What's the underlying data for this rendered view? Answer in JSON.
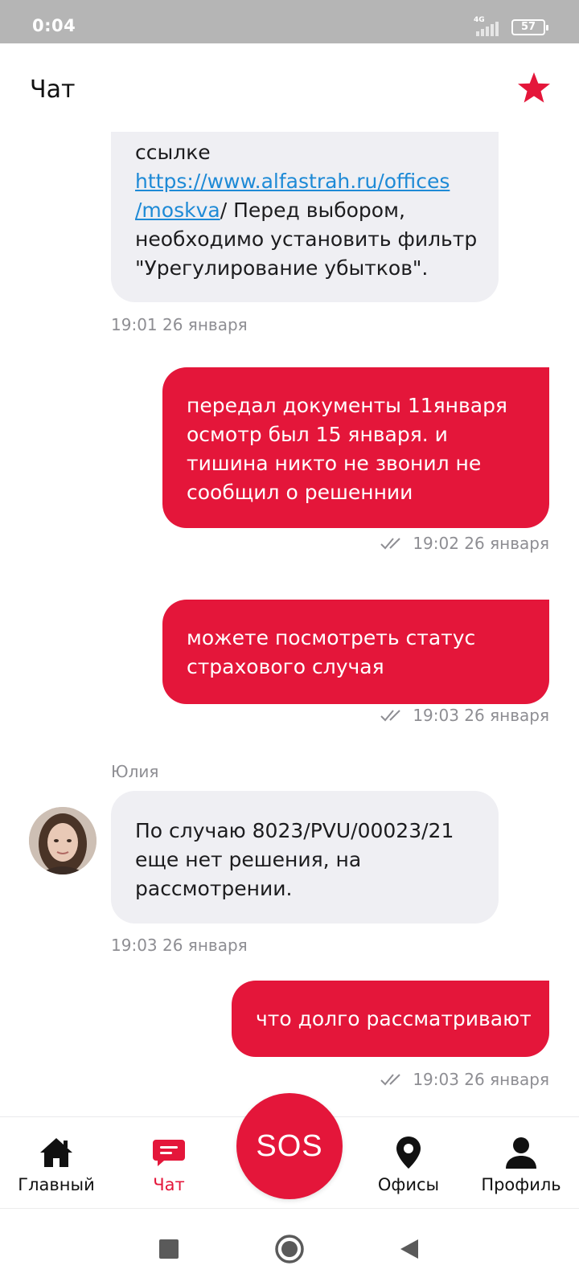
{
  "status_bar": {
    "time": "0:04",
    "network": "4G",
    "battery": "57"
  },
  "header": {
    "title": "Чат",
    "favorite_icon": "star-icon",
    "accent_color": "#e4163a"
  },
  "messages": [
    {
      "direction": "incoming",
      "lines": [
        "ссылке"
      ],
      "link_lines": [
        "https://www.alfastrah.ru/offices",
        "/moskva"
      ],
      "link_tail": "/ Перед выбором,",
      "tail_lines": [
        "необходимо установить фильтр",
        "\"Урегулирование убытков\"."
      ],
      "time": "19:01 26 января"
    },
    {
      "direction": "outgoing",
      "lines": [
        "передал документы 11января",
        "осмотр  был 15 января. и",
        "тишина никто не звонил не",
        "сообщил о решеннии"
      ],
      "time": "19:02 26 января"
    },
    {
      "direction": "outgoing",
      "lines": [
        "можете посмотреть статус",
        "страхового случая"
      ],
      "time": "19:03 26 января"
    },
    {
      "direction": "incoming",
      "sender": "Юлия",
      "lines": [
        "По случаю 8023/PVU/00023/21",
        "еще нет решения, на",
        "рассмотрении."
      ],
      "time": "19:03 26 января"
    },
    {
      "direction": "outgoing",
      "lines": [
        "что долго рассматривают"
      ],
      "time": "19:03 26 января"
    }
  ],
  "bottom_nav": {
    "items": [
      {
        "label": "Главный",
        "icon": "home-icon"
      },
      {
        "label": "Чат",
        "icon": "chat-icon",
        "active": true
      },
      {
        "label": "Офисы",
        "icon": "location-pin-icon"
      },
      {
        "label": "Профиль",
        "icon": "profile-icon"
      }
    ],
    "sos_label": "SOS"
  },
  "system_nav": {
    "icons": [
      "recents-icon",
      "home-circle-icon",
      "back-icon"
    ]
  }
}
